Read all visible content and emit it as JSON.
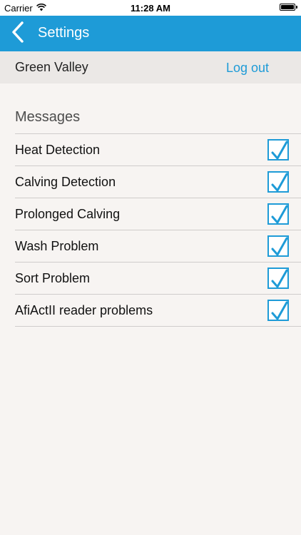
{
  "status_bar": {
    "carrier": "Carrier",
    "time": "11:28 AM"
  },
  "nav": {
    "title": "Settings",
    "back_icon": "chevron-left-icon"
  },
  "farm": {
    "name": "Green Valley",
    "logout_label": "Log out"
  },
  "messages": {
    "header": "Messages",
    "items": [
      {
        "label": "Heat Detection",
        "checked": true
      },
      {
        "label": "Calving Detection",
        "checked": true
      },
      {
        "label": "Prolonged Calving",
        "checked": true
      },
      {
        "label": "Wash Problem",
        "checked": true
      },
      {
        "label": "Sort Problem",
        "checked": true
      },
      {
        "label": "AfiActII reader problems",
        "checked": true
      }
    ]
  },
  "colors": {
    "accent": "#1e9bd7",
    "background": "#f7f4f2",
    "farm_row": "#ebe8e6"
  }
}
